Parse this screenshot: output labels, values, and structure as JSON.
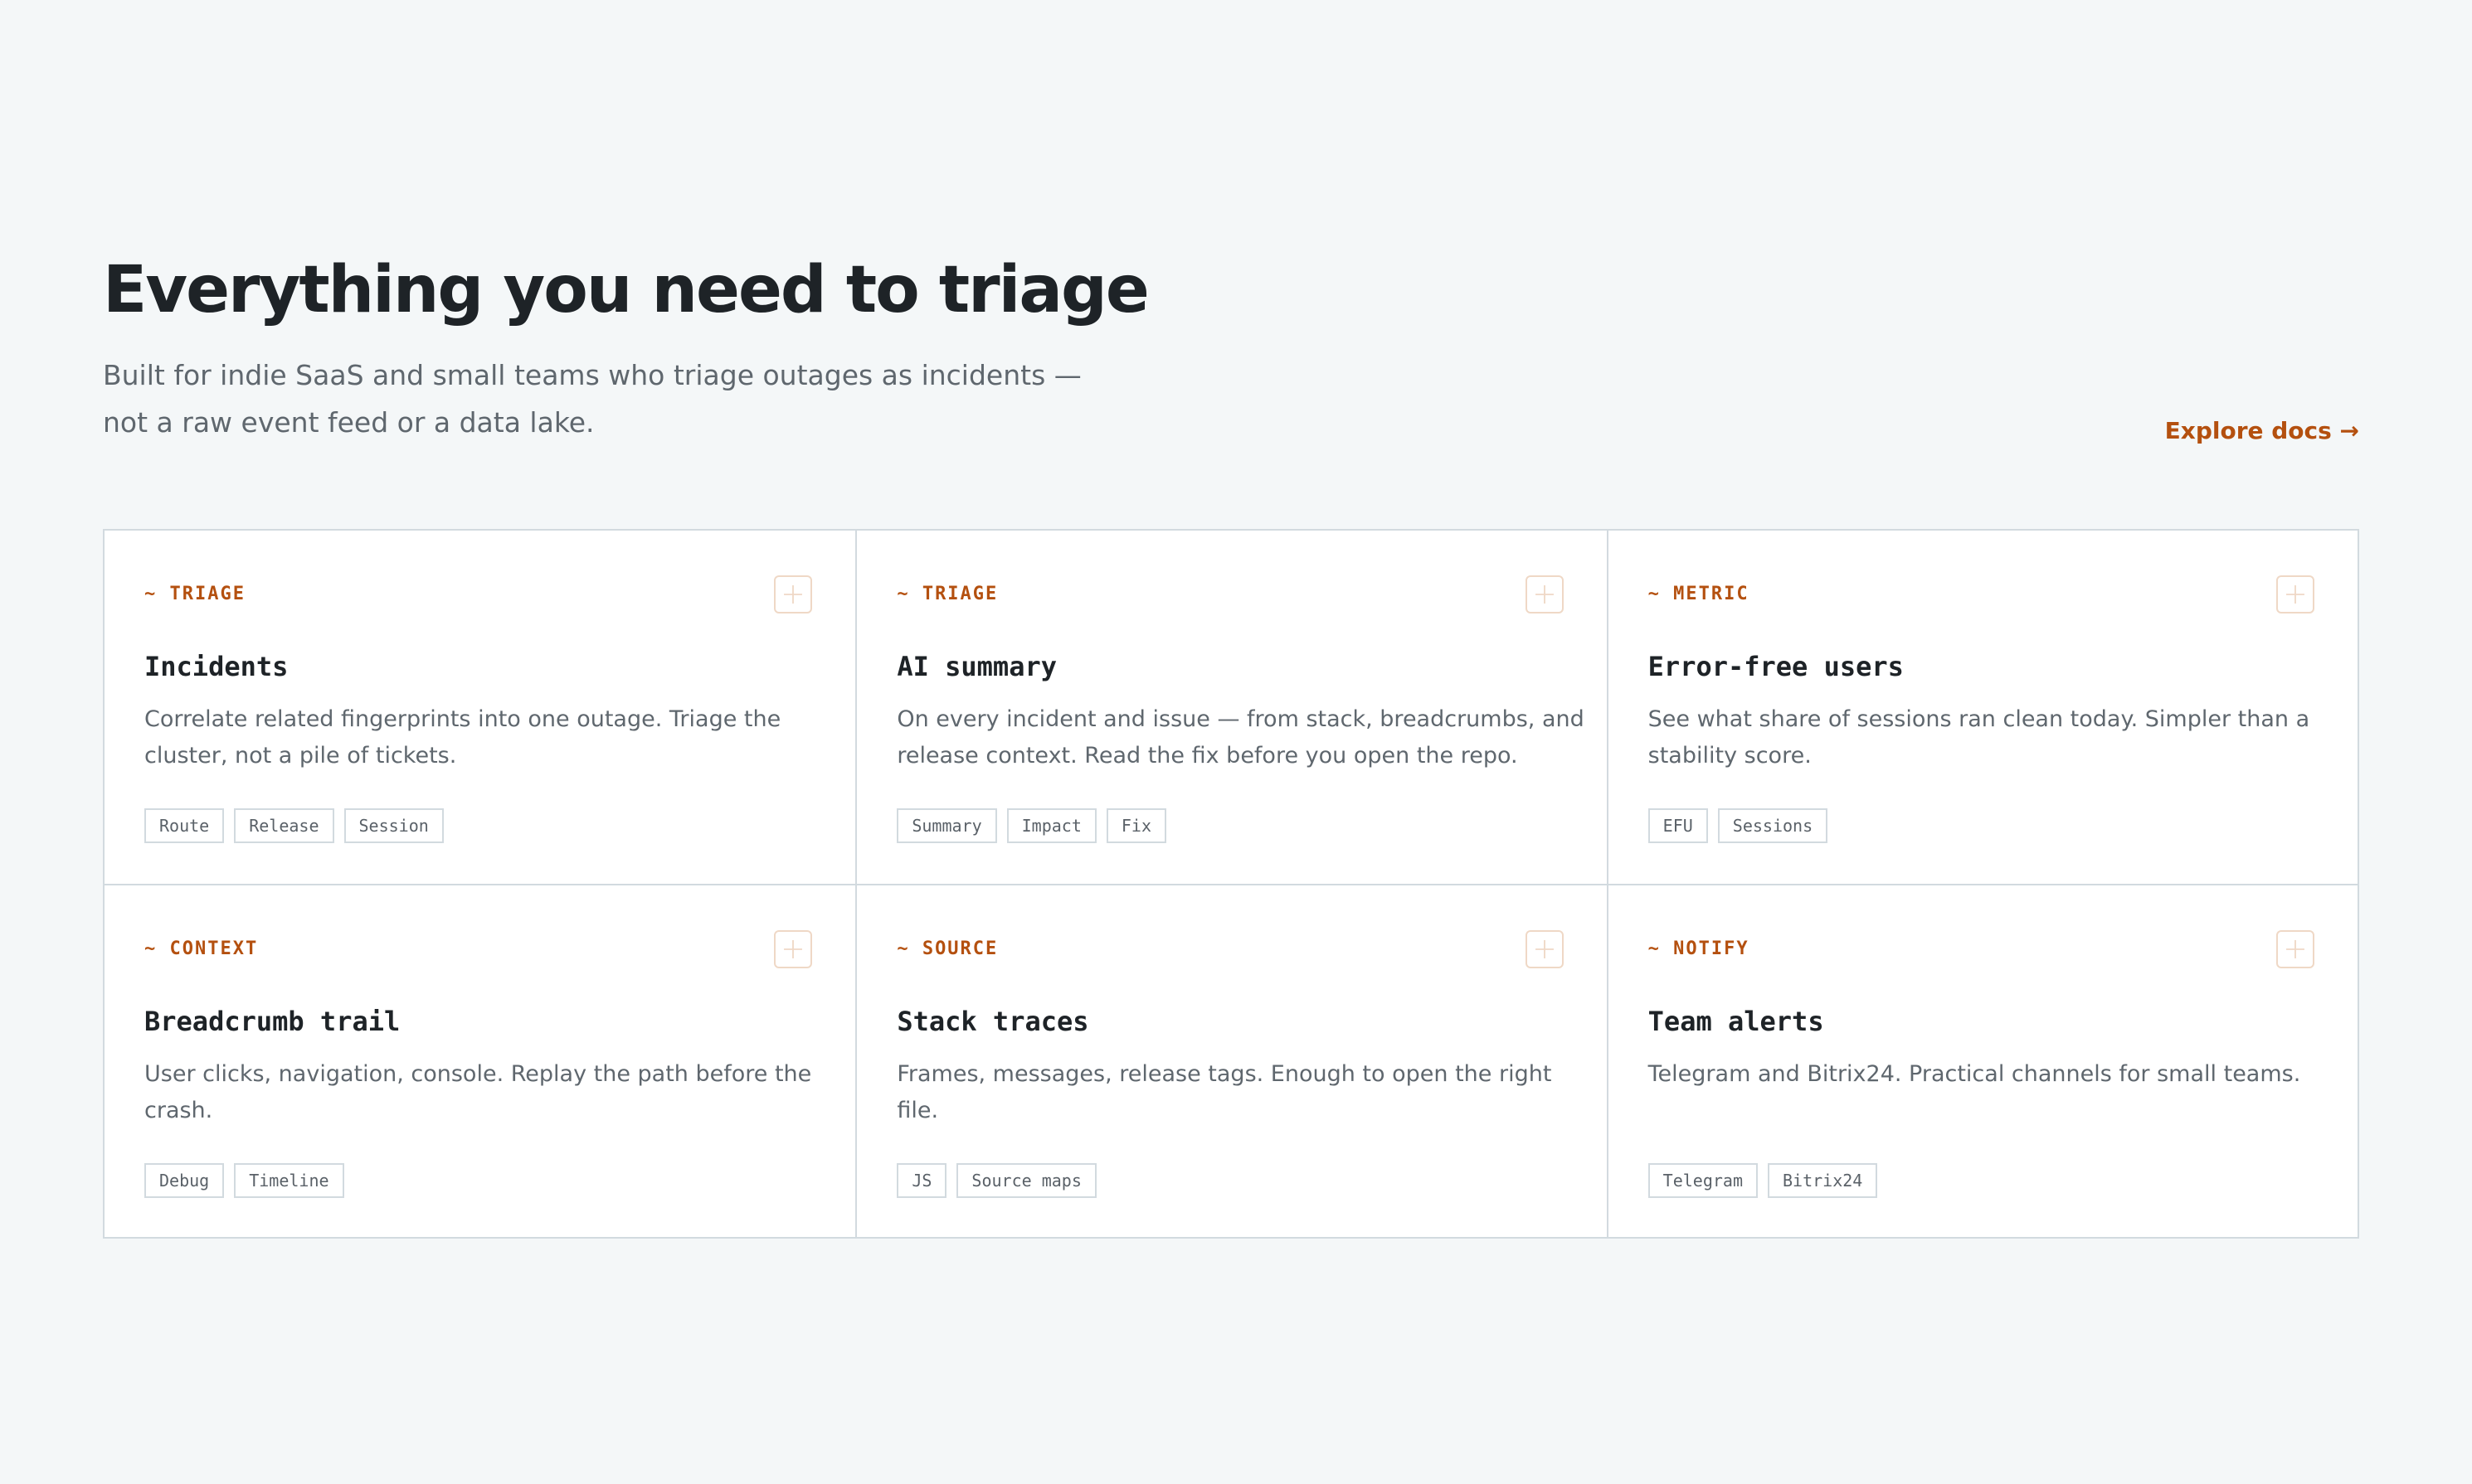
{
  "header": {
    "title": "Everything you need to triage",
    "subtitle": "Built for indie SaaS and small teams who triage outages as incidents — not a raw event feed or a data lake.",
    "explore_link": "Explore docs →"
  },
  "colors": {
    "accent": "#b4500f",
    "background": "#f4f7f8",
    "card_border": "#d2dadf",
    "plus_border": "#efd8c6"
  },
  "features": [
    {
      "category": "~ TRIAGE",
      "title": "Incidents",
      "description": "Correlate related fingerprints into one outage. Triage the cluster, not a pile of tickets.",
      "tags": [
        "Route",
        "Release",
        "Session"
      ],
      "action_icon": "plus-icon"
    },
    {
      "category": "~ TRIAGE",
      "title": "AI summary",
      "description": "On every incident and issue — from stack, breadcrumbs, and release context. Read the fix before you open the repo.",
      "tags": [
        "Summary",
        "Impact",
        "Fix"
      ],
      "action_icon": "plus-icon"
    },
    {
      "category": "~ METRIC",
      "title": "Error-free users",
      "description": "See what share of sessions ran clean today. Simpler than a stability score.",
      "tags": [
        "EFU",
        "Sessions"
      ],
      "action_icon": "plus-icon"
    },
    {
      "category": "~ CONTEXT",
      "title": "Breadcrumb trail",
      "description": "User clicks, navigation, console. Replay the path before the crash.",
      "tags": [
        "Debug",
        "Timeline"
      ],
      "action_icon": "plus-icon"
    },
    {
      "category": "~ SOURCE",
      "title": "Stack traces",
      "description": "Frames, messages, release tags. Enough to open the right file.",
      "tags": [
        "JS",
        "Source maps"
      ],
      "action_icon": "plus-icon"
    },
    {
      "category": "~ NOTIFY",
      "title": "Team alerts",
      "description": "Telegram and Bitrix24. Practical channels for small teams.",
      "tags": [
        "Telegram",
        "Bitrix24"
      ],
      "action_icon": "plus-icon"
    }
  ]
}
